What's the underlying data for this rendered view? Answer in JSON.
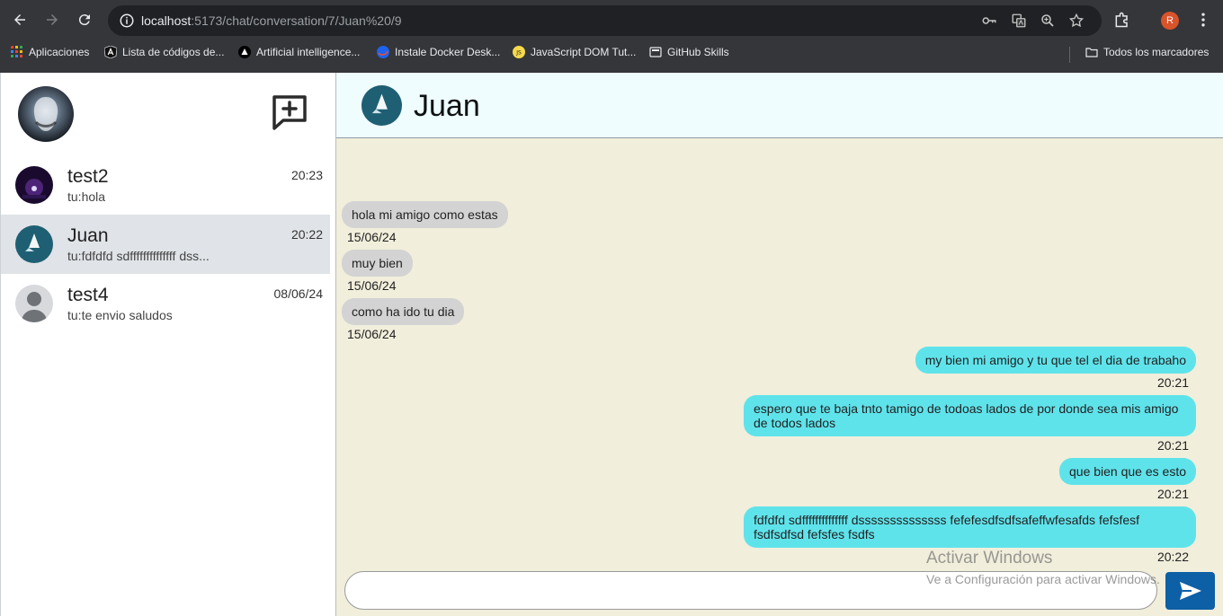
{
  "browser": {
    "url_host": "localhost",
    "url_path": ":5173/chat/conversation/7/Juan%20/9",
    "profile_initial": "R",
    "bookmarks": [
      {
        "label": "Aplicaciones",
        "icon": "apps-grid-icon"
      },
      {
        "label": "Lista de códigos de...",
        "icon": "angular-icon"
      },
      {
        "label": "Artificial intelligence...",
        "icon": "triangle-logo-icon"
      },
      {
        "label": "Instale Docker Desk...",
        "icon": "docker-icon"
      },
      {
        "label": "JavaScript DOM Tut...",
        "icon": "js-icon"
      },
      {
        "label": "GitHub Skills",
        "icon": "github-icon"
      }
    ],
    "all_bookmarks": "Todos los marcadores"
  },
  "sidebar": {
    "conversations": [
      {
        "name": "test2",
        "preview": "tu:hola",
        "time": "20:23"
      },
      {
        "name": "Juan",
        "preview": "tu:fdfdfd sdffffffffffffff dss...",
        "time": "20:22"
      },
      {
        "name": "test4",
        "preview": "tu:te envio saludos",
        "time": "08/06/24"
      }
    ]
  },
  "chat": {
    "contact_name": "Juan",
    "messages": [
      {
        "text": "hola mi amigo como estas",
        "stamp": "15/06/24",
        "direction": "in"
      },
      {
        "text": "muy bien",
        "stamp": "15/06/24",
        "direction": "in"
      },
      {
        "text": "como ha ido tu dia",
        "stamp": "15/06/24",
        "direction": "in"
      },
      {
        "text": "my bien mi amigo y tu que tel el dia de trabaho",
        "stamp": "20:21",
        "direction": "out"
      },
      {
        "text": "espero que te baja tnto tamigo de todoas lados de por donde sea mis amigo de todos lados",
        "stamp": "20:21",
        "direction": "out"
      },
      {
        "text": "que bien que es esto",
        "stamp": "20:21",
        "direction": "out"
      },
      {
        "text": "fdfdfd sdffffffffffffff dssssssssssssss fefefesdfsdfsafeffwfesafds fefsfesf fsdfsdfsd fefsfes fsdfs",
        "stamp": "20:22",
        "direction": "out"
      }
    ],
    "input_value": ""
  },
  "watermark": {
    "title": "Activar Windows",
    "subtitle": "Ve a Configuración para activar Windows."
  },
  "colors": {
    "incoming_bubble": "#d3d3d3",
    "outgoing_bubble": "#5fe3eb",
    "chat_background": "#f1eedb",
    "header_background": "#effdff",
    "send_button": "#0d5fa6"
  }
}
